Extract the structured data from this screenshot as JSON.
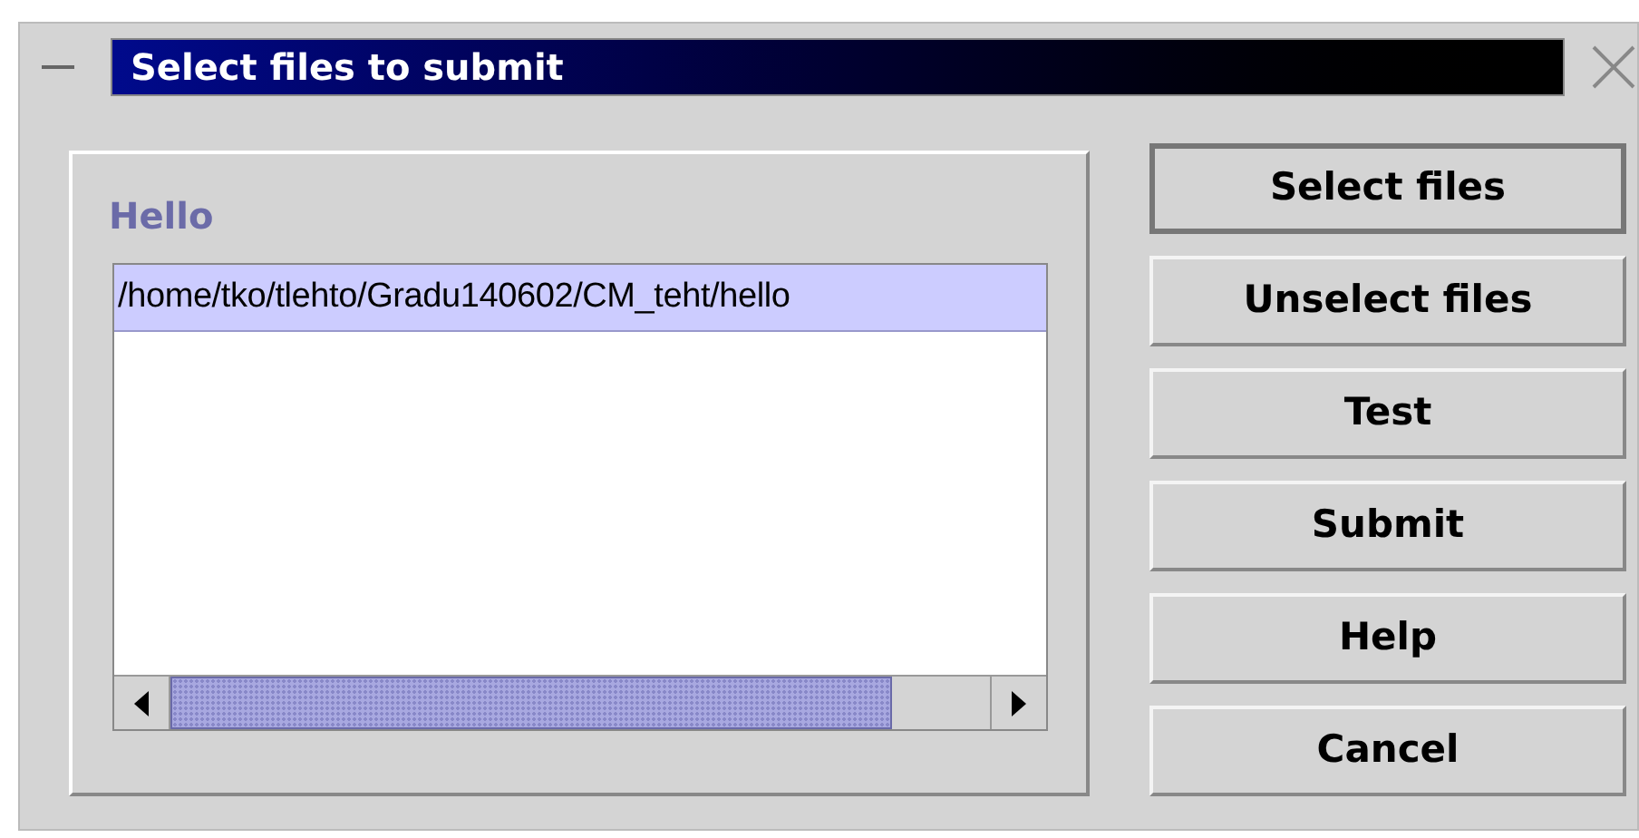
{
  "window": {
    "title": "Select files to submit"
  },
  "panel": {
    "title": "Hello",
    "files": [
      {
        "path": "/home/tko/tlehto/Gradu140602/CM_teht/hello",
        "selected": true
      }
    ]
  },
  "buttons": [
    {
      "label": "Select files",
      "focused": true
    },
    {
      "label": "Unselect files",
      "focused": false
    },
    {
      "label": "Test",
      "focused": false
    },
    {
      "label": "Submit",
      "focused": false
    },
    {
      "label": "Help",
      "focused": false
    },
    {
      "label": "Cancel",
      "focused": false
    }
  ]
}
